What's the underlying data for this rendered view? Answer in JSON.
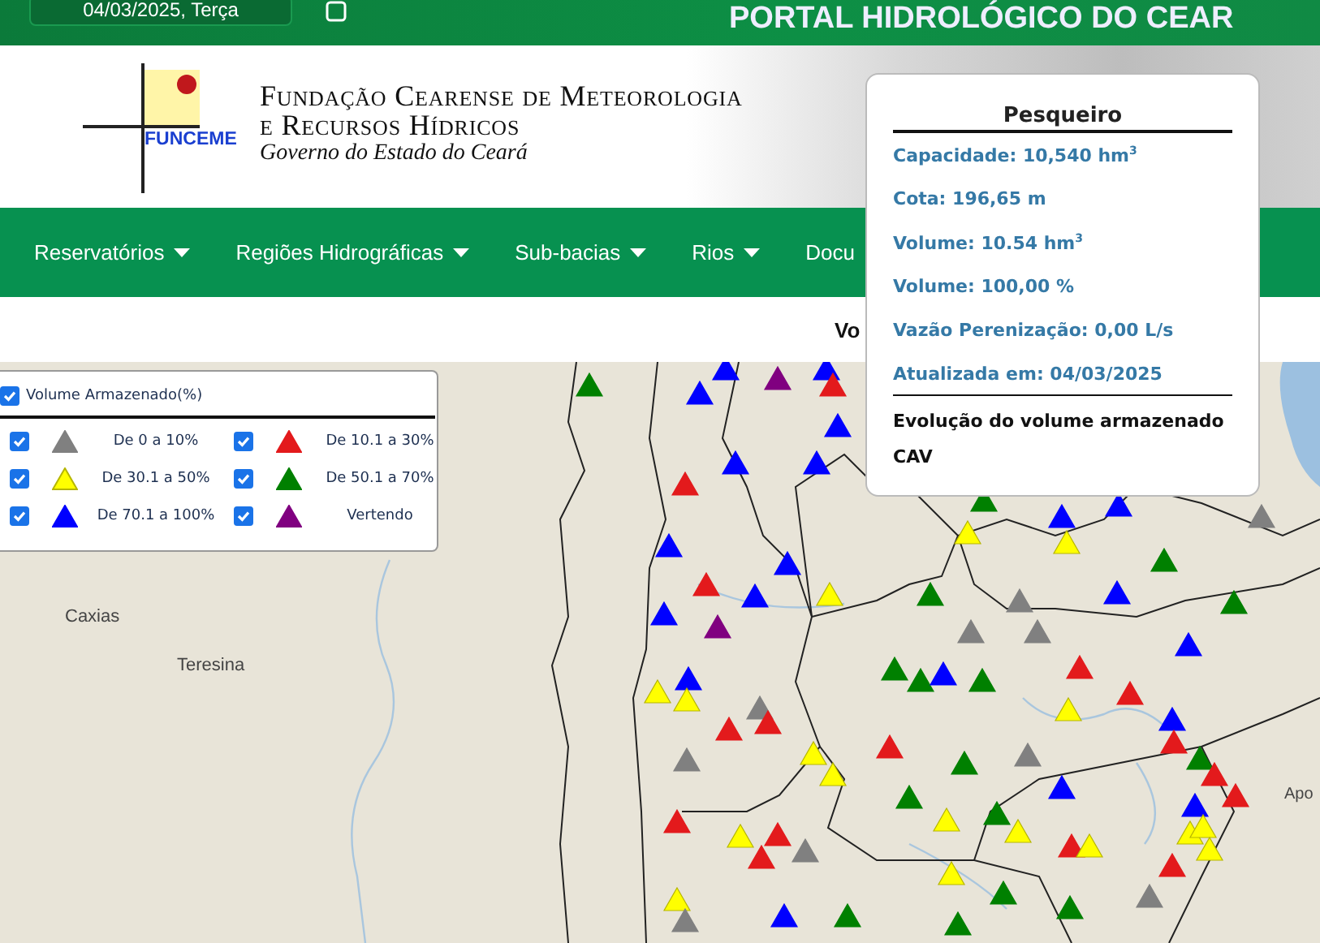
{
  "top_bar": {
    "date": "04/03/2025, Terça",
    "title": "PORTAL HIDROLÓGICO DO CEAR"
  },
  "header": {
    "logo_text": "FUNCEME",
    "org_line_1": "Fundação Cearense de Meteorologia",
    "org_line_2": "e Recursos Hídricos",
    "subtitle": "Governo do Estado do Ceará"
  },
  "nav": [
    {
      "label": "Reservatórios",
      "dropdown": true
    },
    {
      "label": "Regiões Hidrográficas",
      "dropdown": true
    },
    {
      "label": "Sub-bacias",
      "dropdown": true
    },
    {
      "label": "Rios",
      "dropdown": true
    },
    {
      "label": "Docu",
      "dropdown": false
    }
  ],
  "page_heading": "Vo",
  "legend": {
    "title": "Volume Armazenado(%)",
    "checked": true,
    "items": [
      {
        "label": "De 0 a 10%",
        "color": "#808080",
        "checked": true
      },
      {
        "label": "De 10.1 a 30%",
        "color": "#e31a1c",
        "checked": true
      },
      {
        "label": "De 30.1 a 50%",
        "color": "#ffff00",
        "checked": true
      },
      {
        "label": "De 50.1 a 70%",
        "color": "#008000",
        "checked": true
      },
      {
        "label": "De 70.1 a 100%",
        "color": "#0000ff",
        "checked": true
      },
      {
        "label": "Vertendo",
        "color": "#800080",
        "checked": true
      }
    ]
  },
  "map_labels": [
    "Caxias",
    "Teresina",
    "Apo"
  ],
  "popup": {
    "title": "Pesqueiro",
    "fields": [
      "Capacidade: 10,540 hm$^{3}$",
      "Cota: 196,65 m",
      "Volume: 10.54 hm$^{3}$",
      "Volume: 100,00 %",
      "Vazão Perenização: 0,00 L/s",
      "Atualizada em: 04/03/2025"
    ],
    "links": [
      "Evolução do volume armazenado",
      "CAV"
    ]
  }
}
